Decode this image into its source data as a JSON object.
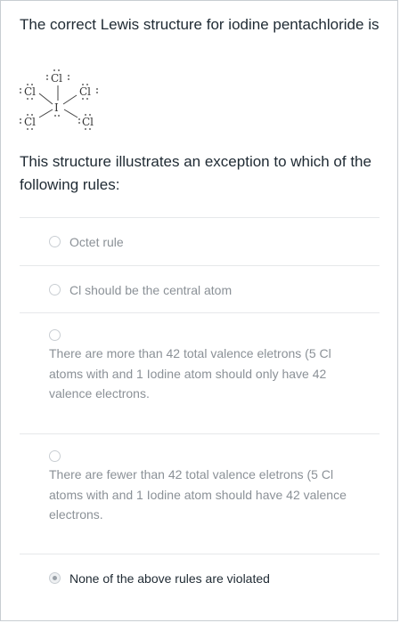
{
  "question": {
    "text": "The correct Lewis structure for iodine pentachloride is"
  },
  "structure": {
    "atom_cl": "Cl",
    "atom_i": "I"
  },
  "instruction": {
    "text": "This structure illustrates an exception to which of the following rules:"
  },
  "options": [
    {
      "label": "Octet rule",
      "selected": false
    },
    {
      "label": "Cl should be the central atom",
      "selected": false
    },
    {
      "label": "There are more than 42 total valence eletrons (5 Cl atoms with and 1 Iodine atom should only have 42 valence electrons.",
      "selected": false
    },
    {
      "label": "There are fewer than 42 total valence eletrons (5 Cl atoms with and 1 Iodine atom should have 42 valence electrons.",
      "selected": false
    },
    {
      "label": "None of the above rules are violated",
      "selected": true
    }
  ]
}
